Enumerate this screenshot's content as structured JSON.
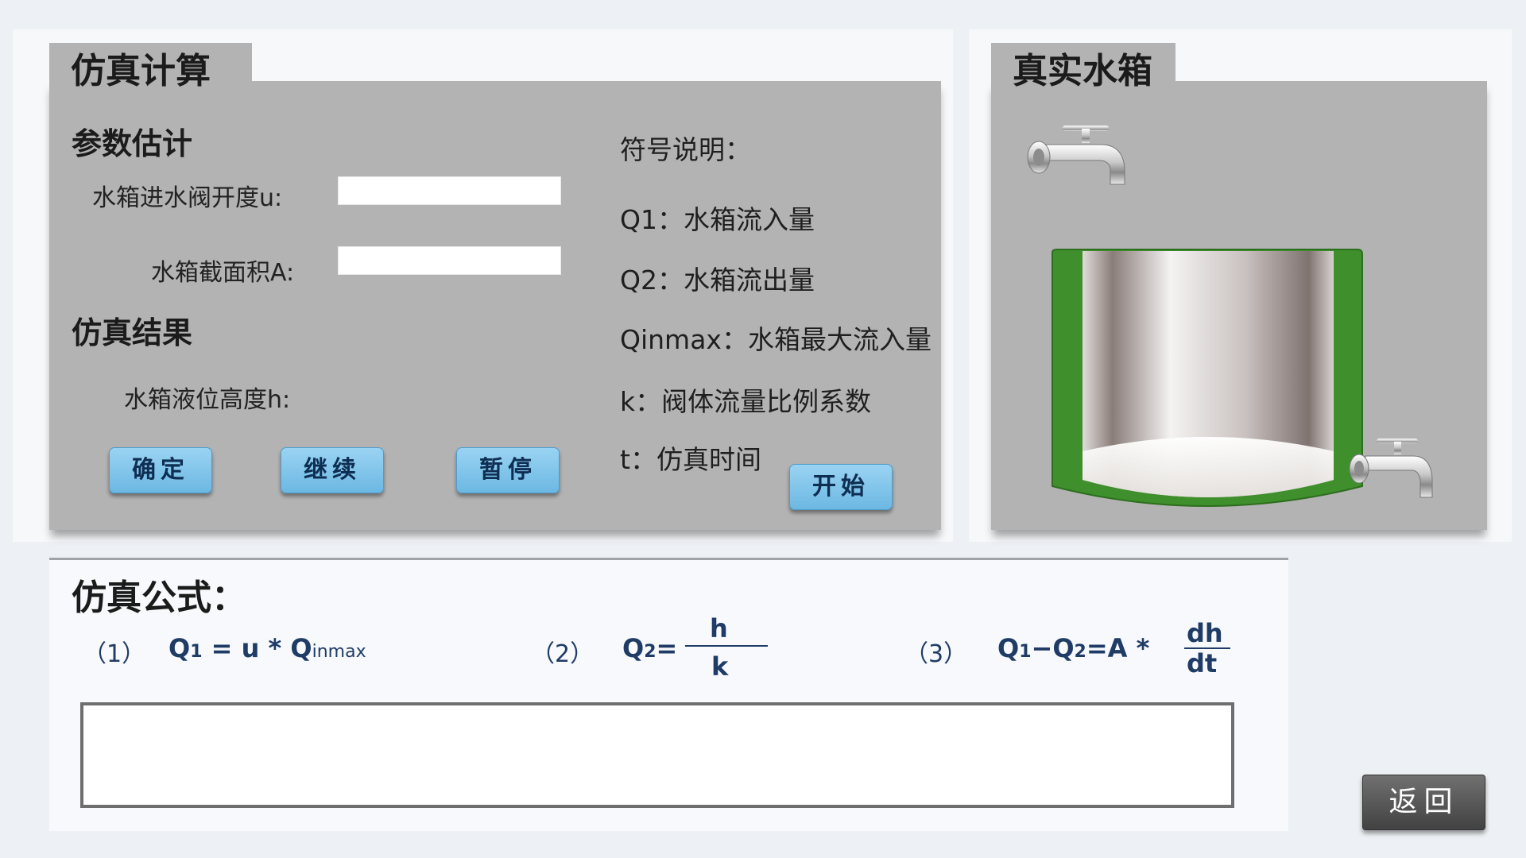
{
  "sim_panel": {
    "tab_title": "仿真计算",
    "param_section": "参数估计",
    "valve_label": "水箱进水阀开度u:",
    "valve_value": "",
    "area_label": "水箱截面积A:",
    "area_value": "",
    "result_section": "仿真结果",
    "level_label": "水箱液位高度h:",
    "level_value": "",
    "legend_title": "符号说明：",
    "legend": [
      "Q1：水箱流入量",
      "Q2：水箱流出量",
      "Qinmax：水箱最大流入量",
      "k：阀体流量比例系数",
      "t：仿真时间"
    ],
    "buttons": {
      "confirm": "确定",
      "continue": "继续",
      "pause": "暂停",
      "start": "开始"
    }
  },
  "tank_panel": {
    "tab_title": "真实水箱"
  },
  "formula": {
    "title": "仿真公式：",
    "f1": {
      "num": "（1）",
      "q": "Q",
      "sub1": "1",
      "mid": " = u * ",
      "q2": "Q",
      "sub2": "inmax"
    },
    "f2": {
      "num": "（2）",
      "q": "Q",
      "sub": "2",
      "eq": "=",
      "numerator": "h",
      "denominator": "k"
    },
    "f3": {
      "num": "（3）",
      "q1": "Q",
      "sub1": "1",
      "minus": "−Q",
      "sub2": "2",
      "rest": "=A *",
      "numerator": "dh",
      "denominator": "dt"
    },
    "output_text": ""
  },
  "back_button": "返回",
  "colors": {
    "panel": "#b3b3b3",
    "button_blue": "#6cb8e3",
    "formula_text": "#1f3c66",
    "tank_green": "#3f8f2c",
    "back_button": "#4a4a4a"
  }
}
